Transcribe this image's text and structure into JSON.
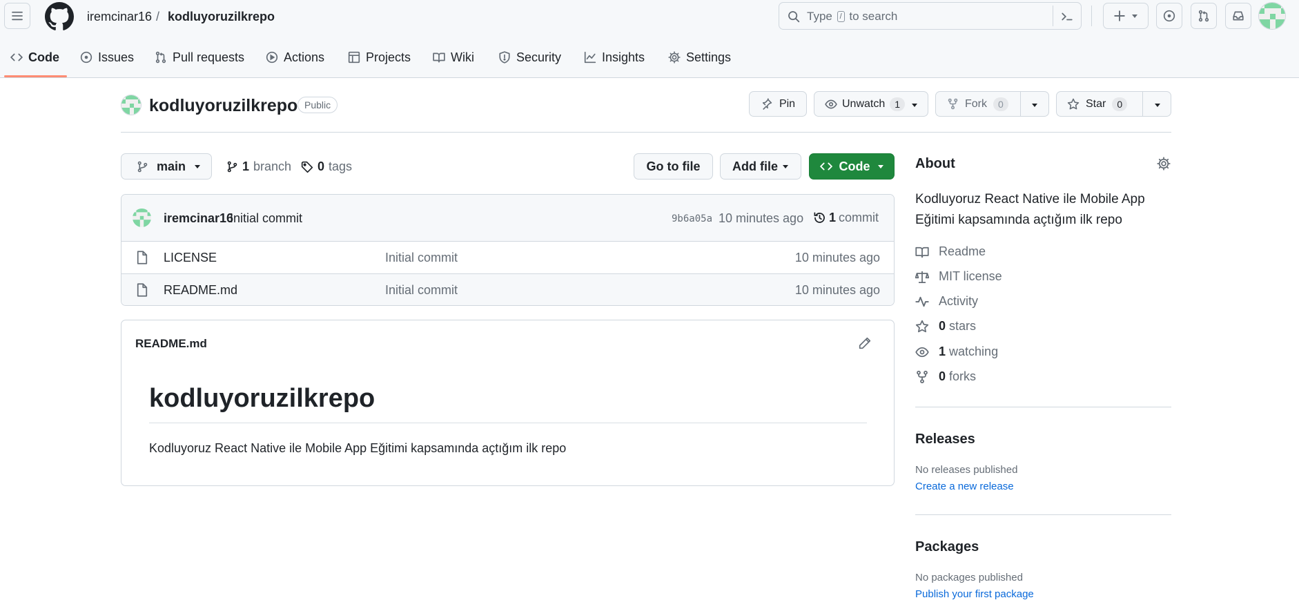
{
  "header": {
    "owner": "iremcinar16",
    "separator": "/",
    "repo": "kodluyoruzilkrepo",
    "search": {
      "prefix": "Type",
      "key": "/",
      "suffix": "to search"
    }
  },
  "nav": {
    "tabs": [
      {
        "label": "Code"
      },
      {
        "label": "Issues"
      },
      {
        "label": "Pull requests"
      },
      {
        "label": "Actions"
      },
      {
        "label": "Projects"
      },
      {
        "label": "Wiki"
      },
      {
        "label": "Security"
      },
      {
        "label": "Insights"
      },
      {
        "label": "Settings"
      }
    ],
    "active": "Code"
  },
  "repo": {
    "name": "kodluyoruzilkrepo",
    "visibility": "Public",
    "pin_label": "Pin",
    "unwatch_label": "Unwatch",
    "watch_count": "1",
    "fork_label": "Fork",
    "fork_count": "0",
    "star_label": "Star",
    "star_count": "0"
  },
  "toolbar": {
    "branch": "main",
    "branch_count": "1",
    "branch_label": "branch",
    "tag_count": "0",
    "tag_label": "tags",
    "go_to_file": "Go to file",
    "add_file": "Add file",
    "code": "Code"
  },
  "commit": {
    "author": "iremcinar16",
    "message": "Initial commit",
    "sha": "9b6a05a",
    "time": "10 minutes ago",
    "count": "1",
    "count_label": "commit"
  },
  "files": [
    {
      "name": "LICENSE",
      "message": "Initial commit",
      "time": "10 minutes ago"
    },
    {
      "name": "README.md",
      "message": "Initial commit",
      "time": "10 minutes ago"
    }
  ],
  "readme": {
    "filename": "README.md",
    "heading": "kodluyoruzilkrepo",
    "body": "Kodluyoruz React Native ile Mobile App Eğitimi kapsamında açtığım ilk repo"
  },
  "about": {
    "title": "About",
    "description": "Kodluyoruz React Native ile Mobile App Eğitimi kapsamında açtığım ilk repo",
    "readme": "Readme",
    "license": "MIT license",
    "activity": "Activity",
    "stars_count": "0",
    "stars_label": "stars",
    "watching_count": "1",
    "watching_label": "watching",
    "forks_count": "0",
    "forks_label": "forks"
  },
  "releases": {
    "title": "Releases",
    "empty": "No releases published",
    "link": "Create a new release"
  },
  "packages": {
    "title": "Packages",
    "empty": "No packages published",
    "link": "Publish your first package"
  },
  "colors": {
    "accent_green": "#1f883d",
    "link_blue": "#0969da",
    "active_tab_underline": "#fd8c73"
  }
}
